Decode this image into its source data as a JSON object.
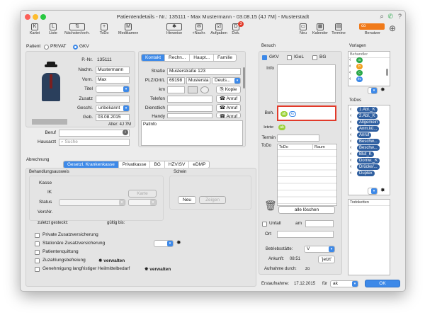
{
  "window": {
    "title": "Patientendetails - Nr.: 135111 - Max Mustermann - 03.08.15 (4J 7M) - Musterstadt"
  },
  "toolbar": {
    "left": [
      {
        "label": "Kartei",
        "icon": "K"
      },
      {
        "label": "Liste",
        "icon": "L"
      },
      {
        "label": "Nächster/vorh.",
        "icon": "⇅"
      },
      {
        "label": "ToDo",
        "icon": "+"
      },
      {
        "label": "Medikamente",
        "icon": "M"
      }
    ],
    "middle": [
      {
        "label": "Hinweise",
        "icon": "✱"
      },
      {
        "label": "+Nachr.",
        "icon": "✉"
      },
      {
        "label": "Aufgaben",
        "icon": "☑"
      },
      {
        "label": "Dok.",
        "icon": "D"
      }
    ],
    "right": [
      {
        "label": "Neu",
        "icon": "▭"
      },
      {
        "label": "Kalender",
        "icon": "▦"
      },
      {
        "label": "Termine",
        "icon": "▤"
      }
    ],
    "dok_badge": "3",
    "user_label": "Benutzer",
    "user_value": "co"
  },
  "patient": {
    "label": "Patient",
    "privat": "PRIVAT",
    "gkv": "GKV",
    "pnr_label": "P.-Nr.",
    "pnr": "135111",
    "nachn_label": "Nachn.",
    "nachn": "Mustermann",
    "vorn_label": "Vorn.",
    "vorn": "Max",
    "titel_label": "Titel",
    "zusatz_label": "Zusatz",
    "geschl_label": "Geschl.",
    "geschl": "unbekannt",
    "geb_label": "Geb.",
    "geb": "03.08.2015",
    "alter": "Alter: 4J 7M",
    "beruf_label": "Beruf",
    "hausarzt_label": "Hausarzt",
    "hausarzt_placeholder": "Suche"
  },
  "contact": {
    "tabs": [
      "Kontakt",
      "Rechn...",
      "Haupt...",
      "Familie"
    ],
    "strasse_label": "Straße",
    "strasse": "Musterstraße 123",
    "plz_label": "PLZ/Ort/L",
    "plz": "69198",
    "ort": "Mustersta",
    "land": "Deuts...",
    "km_label": "km",
    "kopie": "Kopie",
    "telefon_label": "Telefon",
    "anruf": "Anruf",
    "dienst_label": "Dienstlich",
    "handy_label": "Handy",
    "patinfo_label": "PatInfo"
  },
  "abrechnung": {
    "label": "Abrechnung",
    "tabs": [
      "Gesetzl. Krankenkasse",
      "Privatkasse",
      "BG",
      "HZV/SV",
      "eDMP"
    ],
    "ausweis_label": "Behandlungsausweis",
    "kasse": "Kasse",
    "ik": "IK",
    "karte": "Karte",
    "status": "Status",
    "versnr": "VersNr.",
    "zuletzt": "zuletzt gesteckt:",
    "gueltig": "gültig bis:",
    "schein_label": "Schein",
    "neu": "Neu",
    "zeigen": "Zeigen",
    "checks": [
      "Private Zusatzversicherung",
      "Stationäre Zusatzversicherung",
      "Patientenquittung",
      "Zuzahlungsbefreiung",
      "Genehmigung langfristiger Heilmittelbedarf"
    ],
    "verwalten": "verwalten"
  },
  "besuch": {
    "label": "Besuch",
    "gkv": "GKV",
    "igel": "IGeL",
    "bg": "BG",
    "info": "Info",
    "beh": "Beh.",
    "beh_ab": "ab",
    "beh_kv": "kv",
    "letzte": "letzte:",
    "letzte_badge": "ab",
    "termin": "Termin",
    "todo_label": "ToDo",
    "todo_col": "ToDo",
    "raum_col": "Raum",
    "alle_loeschen": "alle löschen",
    "unfall": "Unfall",
    "am": "am",
    "ort": "Ort",
    "betriebsstaette_label": "Betriebsstätte:",
    "betriebsstaette": "V",
    "ankunft_label": "Ankunft:",
    "ankunft": "08:51",
    "jetzt": "'jetzt'",
    "aufnahme_label": "Aufnahme durch:",
    "aufnahme": "zo"
  },
  "vorlagen": {
    "label": "Vorlagen",
    "behandler_label": "Behandler",
    "behandler_badges": [
      {
        "label": "a",
        "color": "#2aa84a"
      },
      {
        "label": "b",
        "color": "#f0a020"
      },
      {
        "label": "c",
        "color": "#2aa84a"
      },
      {
        "label": "kv",
        "color": "#3d89e8"
      }
    ],
    "todos_label": "ToDos",
    "todos": [
      "1.Abl._K",
      "2.Abl._K",
      "Allgemein",
      "Anm.kü...",
      "Anruf",
      "Beschw...",
      "Beschw...",
      "Blut_K",
      "Dornw._K",
      "Drücke/...",
      "Duplex"
    ],
    "todoketten_label": "Todoketten"
  },
  "footer": {
    "erstaufnahme_label": "Erstaufnahme:",
    "erstaufnahme": "17.12.2015",
    "fuer": "für",
    "fuer_value": "ak",
    "ok": "OK"
  }
}
